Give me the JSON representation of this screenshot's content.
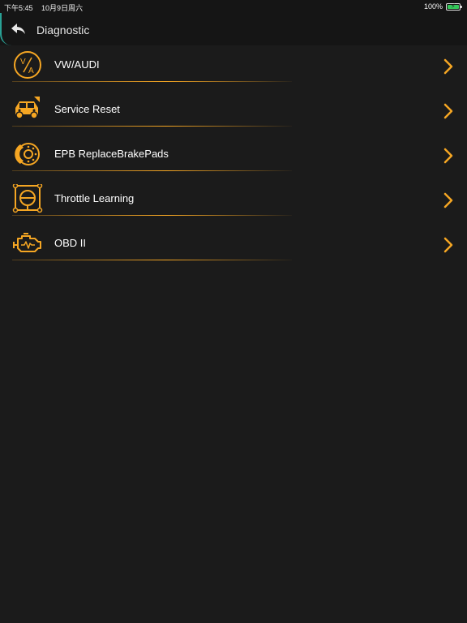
{
  "status_bar": {
    "time": "下午5:45",
    "date": "10月9日周六",
    "battery": "100%"
  },
  "nav": {
    "title": "Diagnostic",
    "back_icon": "back-arrow-icon"
  },
  "accent_color": "#f5a623",
  "menu": [
    {
      "label": "VW/AUDI",
      "icon": "vw-audi-icon"
    },
    {
      "label": "Service Reset",
      "icon": "service-car-icon"
    },
    {
      "label": "EPB ReplaceBrakePads",
      "icon": "brake-disc-icon"
    },
    {
      "label": "Throttle Learning",
      "icon": "throttle-icon"
    },
    {
      "label": "OBD II",
      "icon": "engine-icon"
    }
  ]
}
